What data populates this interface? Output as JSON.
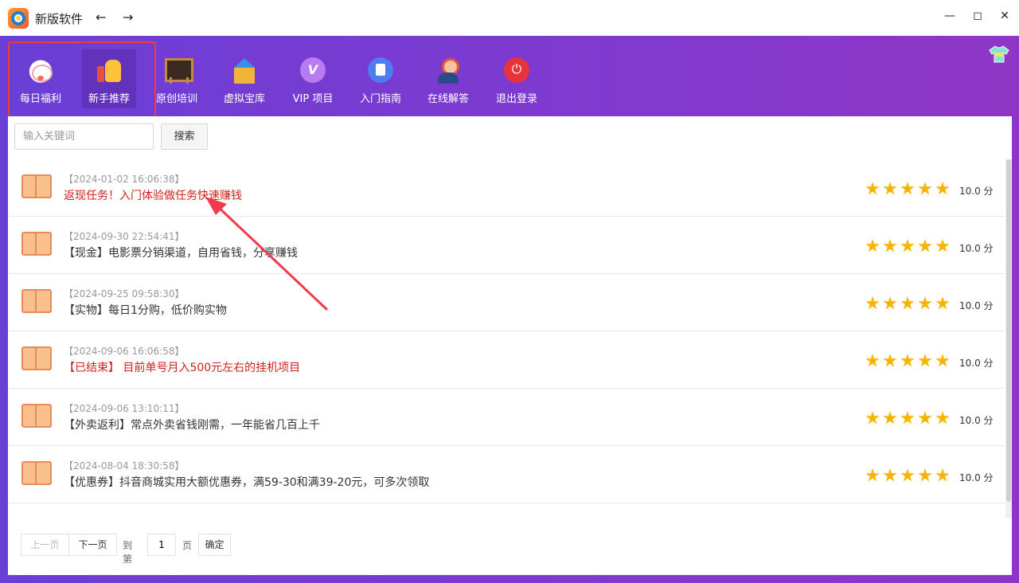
{
  "window": {
    "title": "新版软件"
  },
  "toolbar": {
    "items": [
      {
        "label": "每日福利",
        "icon": "lucky-cat-icon"
      },
      {
        "label": "新手推荐",
        "icon": "thumbs-up-icon"
      },
      {
        "label": "原创培训",
        "icon": "chalkboard-icon"
      },
      {
        "label": "虚拟宝库",
        "icon": "treasury-icon"
      },
      {
        "label": "VIP 项目",
        "icon": "vip-icon"
      },
      {
        "label": "入门指南",
        "icon": "guide-icon"
      },
      {
        "label": "在线解答",
        "icon": "customer-service-icon"
      },
      {
        "label": "退出登录",
        "icon": "power-icon"
      }
    ],
    "active_index": 1
  },
  "search": {
    "placeholder": "输入关键词",
    "button": "搜索"
  },
  "list": [
    {
      "time": "【2024-01-02 16:06:38】",
      "title": "返现任务！入门体验做任务快速赚钱",
      "red": true,
      "score": "10.0 分",
      "stars": 5
    },
    {
      "time": "【2024-09-30 22:54:41】",
      "title": "【现金】电影票分销渠道，自用省钱，分享赚钱",
      "red": false,
      "score": "10.0 分",
      "stars": 5
    },
    {
      "time": "【2024-09-25 09:58:30】",
      "title": "【实物】每日1分购，低价购实物",
      "red": false,
      "score": "10.0 分",
      "stars": 5
    },
    {
      "time": "【2024-09-06 16:06:58】",
      "title": "【已结束】 目前单号月入500元左右的挂机项目",
      "red": true,
      "score": "10.0 分",
      "stars": 5
    },
    {
      "time": "【2024-09-06 13:10:11】",
      "title": "【外卖返利】常点外卖省钱刚需，一年能省几百上千",
      "red": false,
      "score": "10.0 分",
      "stars": 5
    },
    {
      "time": "【2024-08-04 18:30:58】",
      "title": "【优惠券】抖音商城实用大额优惠券，满59-30和满39-20元，可多次领取",
      "red": false,
      "score": "10.0 分",
      "stars": 5
    }
  ],
  "pager": {
    "prev": "上一页",
    "next": "下一页",
    "goto_prefix": "到第",
    "page_value": "1",
    "goto_suffix": "页",
    "confirm": "确定"
  },
  "colors": {
    "accent_purple": "#7d3ad0",
    "title_red": "#d0201a",
    "star": "#f5b400",
    "annotation": "#f03c4c"
  }
}
